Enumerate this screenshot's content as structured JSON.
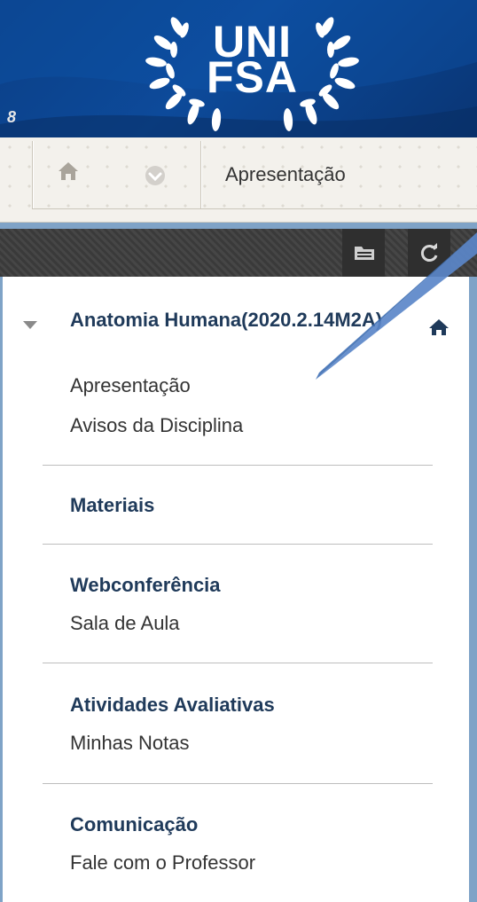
{
  "banner": {
    "logo_line1": "UNI",
    "logo_line2": "FSA",
    "badge": "8"
  },
  "breadcrumb": {
    "current": "Apresentação",
    "home_icon": "home-icon",
    "menu_icon": "chevron-down-circle-icon"
  },
  "toolbar": {
    "folder_icon": "folder-view-icon",
    "refresh_icon": "refresh-icon"
  },
  "course_menu": {
    "course_title": "Anatomia Humana(2020.2.14M2A)",
    "items": [
      {
        "label": "Apresentação",
        "type": "link"
      },
      {
        "label": "Avisos da Disciplina",
        "type": "link"
      },
      {
        "label": "Materiais",
        "type": "heading"
      },
      {
        "label": "Webconferência",
        "type": "heading"
      },
      {
        "label": "Sala de Aula",
        "type": "link"
      },
      {
        "label": "Atividades Avaliativas",
        "type": "heading"
      },
      {
        "label": "Minhas Notas",
        "type": "link"
      },
      {
        "label": "Comunicação",
        "type": "heading"
      },
      {
        "label": "Fale com o Professor",
        "type": "link"
      }
    ]
  },
  "colors": {
    "banner": "#0b3f86",
    "heading": "#1f3a5a",
    "callout_arrow": "#5b87c9",
    "frame": "#7fa3c7"
  }
}
